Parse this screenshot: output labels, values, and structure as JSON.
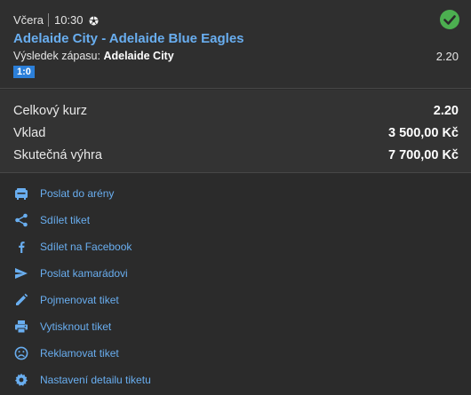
{
  "match": {
    "day": "Včera",
    "time": "10:30",
    "sport_icon": "soccer-ball-icon",
    "status_icon": "check-circle-icon",
    "status_color": "#4caf50",
    "title": "Adelaide City - Adelaide Blue Eagles",
    "market_label": "Výsledek zápasu:",
    "selection": "Adelaide City",
    "odds": "2.20",
    "score": "1:0"
  },
  "summary": {
    "total_odds_label": "Celkový kurz",
    "total_odds_value": "2.20",
    "stake_label": "Vklad",
    "stake_value": "3 500,00 Kč",
    "win_label": "Skutečná výhra",
    "win_value": "7 700,00 Kč"
  },
  "actions": [
    {
      "label": "Poslat do arény",
      "icon": "arena-icon"
    },
    {
      "label": "Sdílet tiket",
      "icon": "share-icon"
    },
    {
      "label": "Sdílet na Facebook",
      "icon": "facebook-icon"
    },
    {
      "label": "Poslat kamarádovi",
      "icon": "send-icon"
    },
    {
      "label": "Pojmenovat tiket",
      "icon": "pencil-icon"
    },
    {
      "label": "Vytisknout tiket",
      "icon": "print-icon"
    },
    {
      "label": "Reklamovat tiket",
      "icon": "sad-face-icon"
    },
    {
      "label": "Nastavení detailu tiketu",
      "icon": "gear-icon"
    }
  ],
  "colors": {
    "accent": "#69aef0",
    "score_badge": "#2b7fd9",
    "background": "#2b2b2b"
  }
}
